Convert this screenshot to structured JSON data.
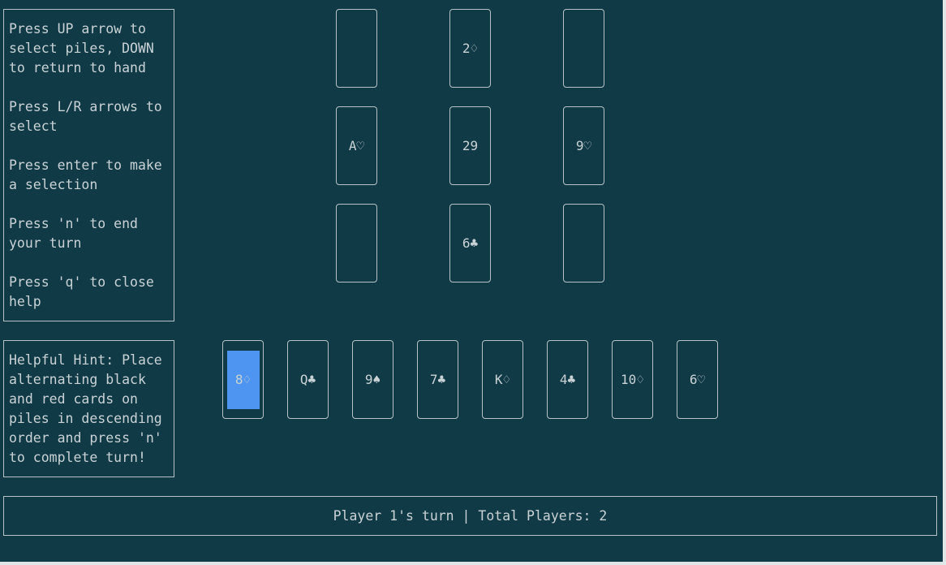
{
  "help": {
    "text": "Press UP arrow to\nselect piles, DOWN\nto return to hand\n\nPress L/R arrows to\nselect\n\nPress enter to make\na selection\n\nPress 'n' to end\nyour turn\n\nPress 'q' to close\nhelp"
  },
  "hint": {
    "text": "Helpful Hint: Place\nalternating black\nand red cards on\npiles in descending\norder and press 'n'\nto complete turn!"
  },
  "piles": {
    "row1": [
      "",
      "2♢",
      ""
    ],
    "row2": [
      "A♡",
      "29",
      "9♡"
    ],
    "row3": [
      "",
      "6♣",
      ""
    ]
  },
  "hand": {
    "cards": [
      "8♢",
      "Q♣",
      "9♠",
      "7♣",
      "K♢",
      "4♣",
      "10♢",
      "6♡"
    ],
    "selected_index": 0
  },
  "status": {
    "text": "Player 1's turn | Total Players: 2"
  },
  "colors": {
    "background": "#113a47",
    "border": "#b7c3c7",
    "text": "#c9d3d6",
    "selection": "#4d95f0"
  }
}
